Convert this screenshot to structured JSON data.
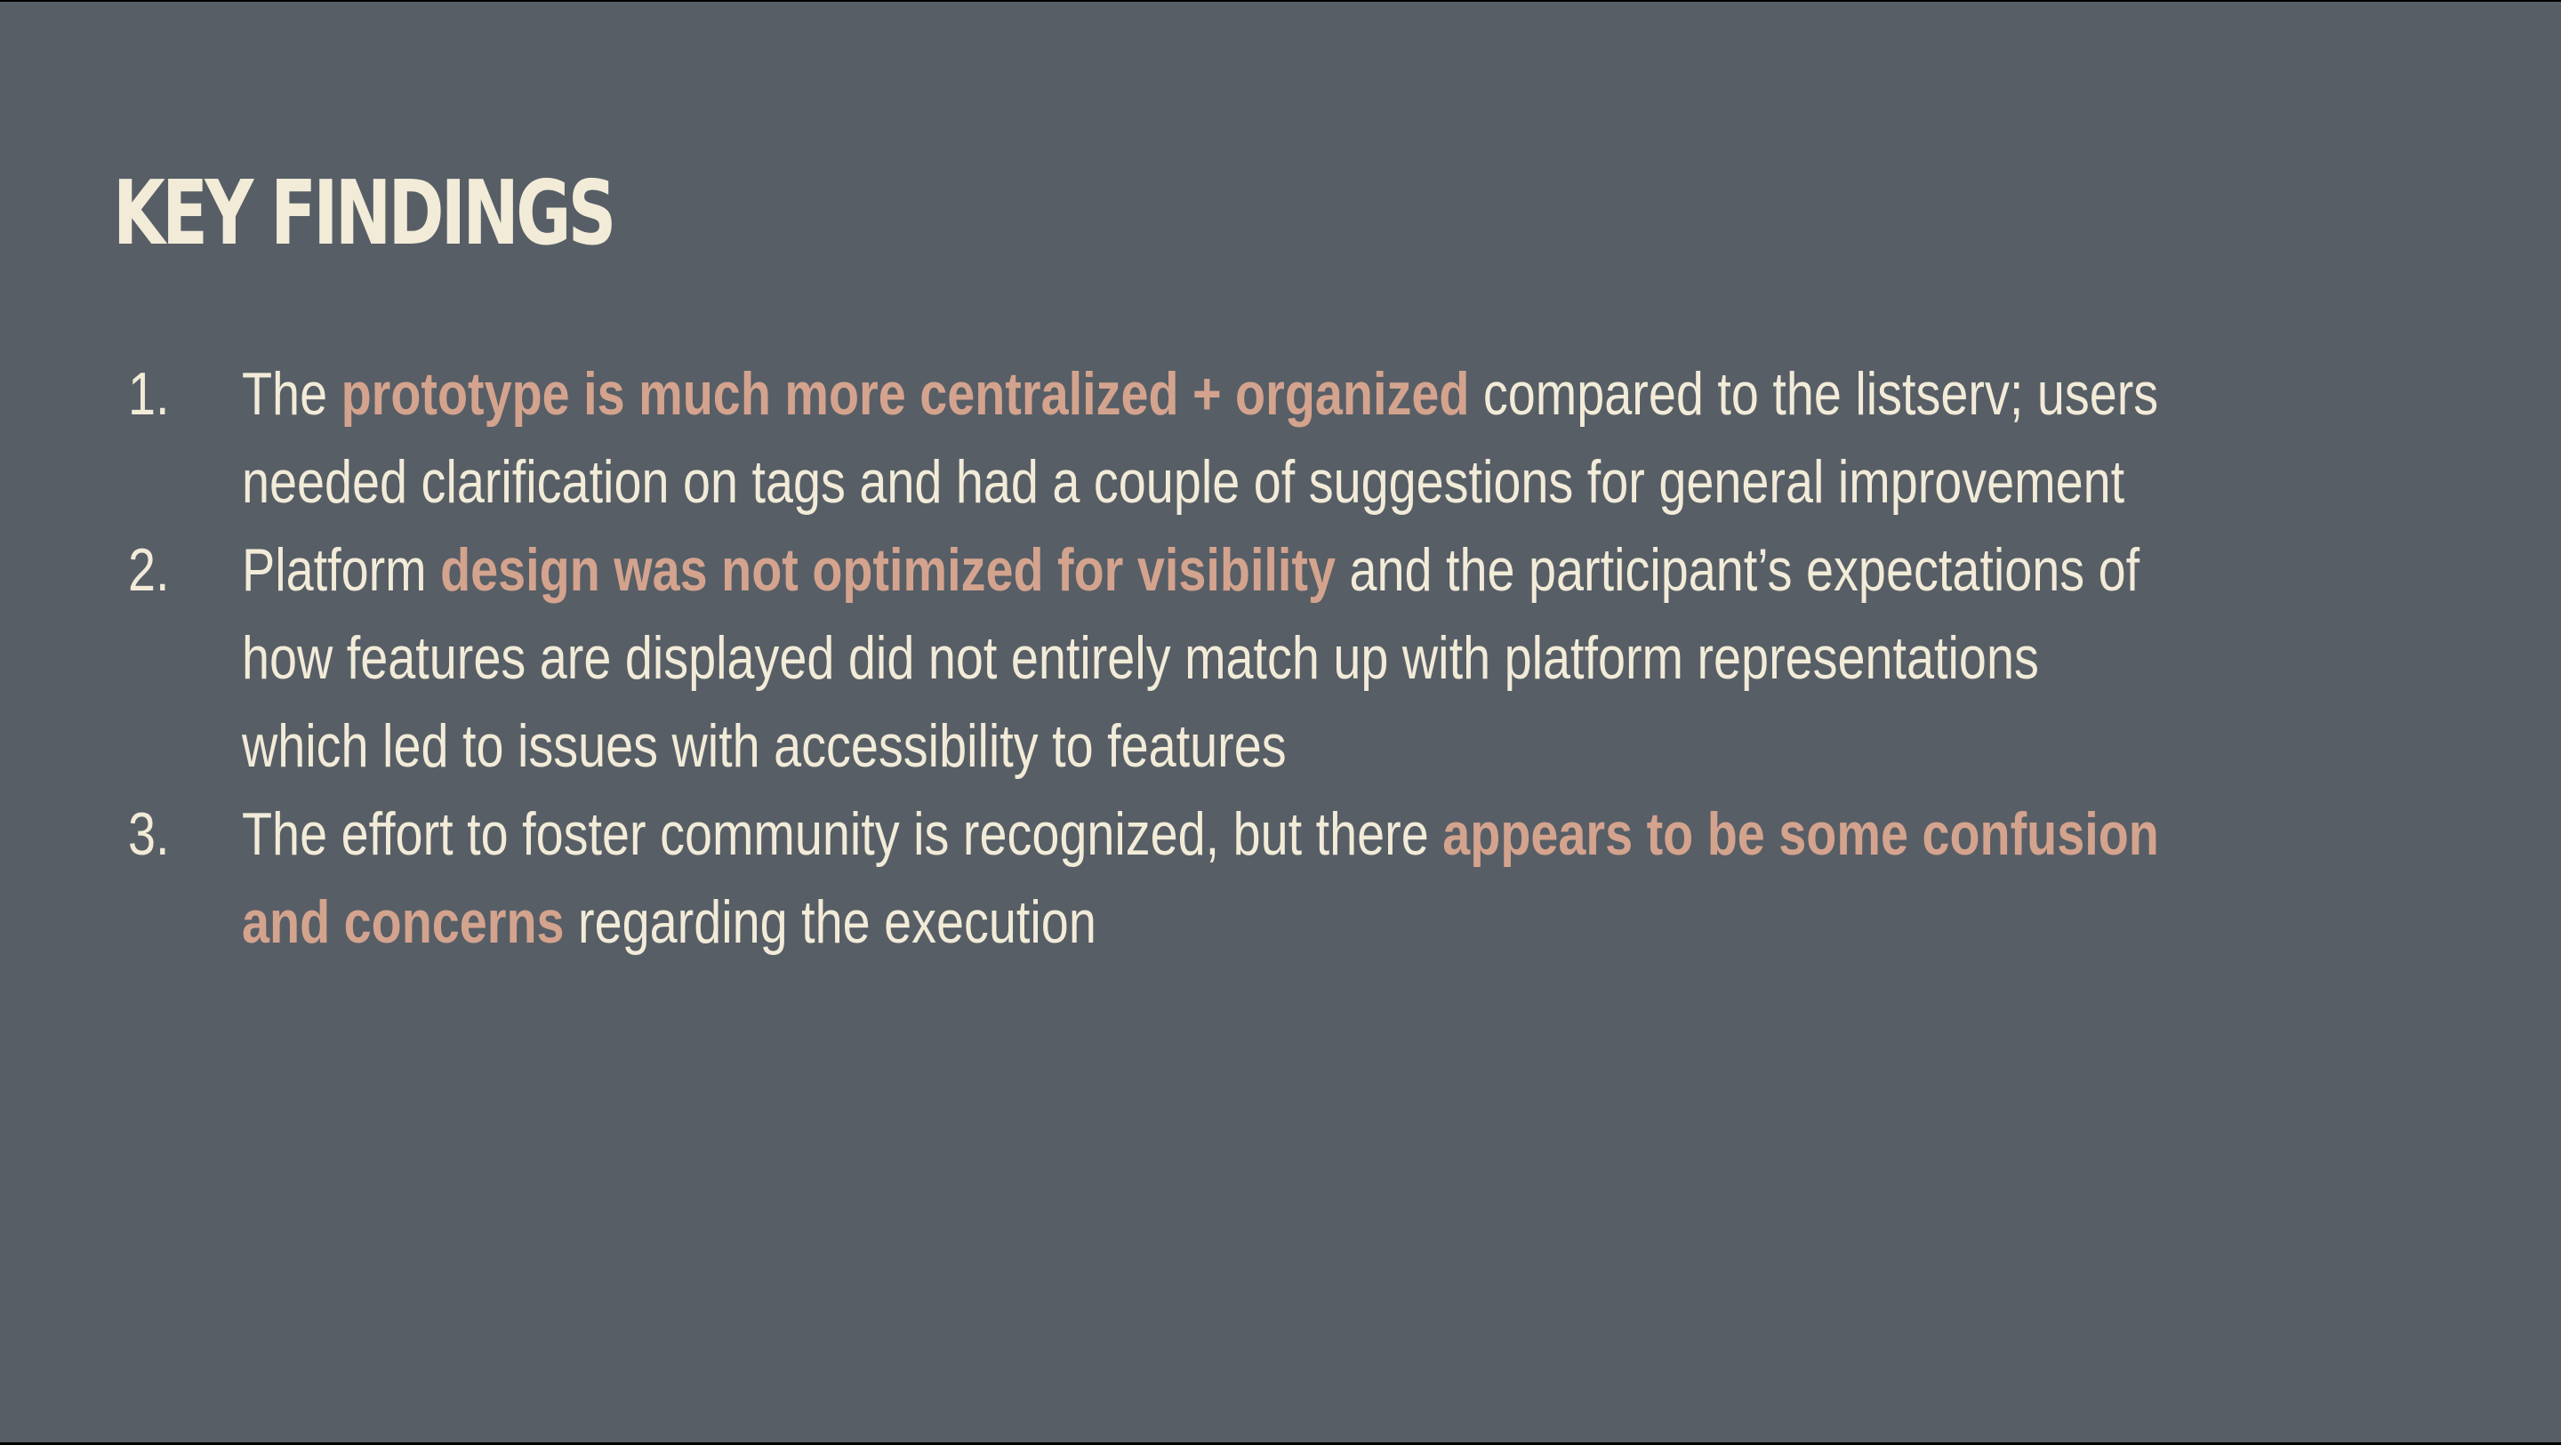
{
  "slide": {
    "title": "KEY FINDINGS",
    "background_color": "#575e66",
    "text_color": "#f1ebd8",
    "highlight_color": "#d4a38e"
  },
  "findings": [
    {
      "number": "1.",
      "line1_part1": "The ",
      "line1_highlight": "prototype is much more centralized + organized",
      "line1_part2": " compared to the listserv; users",
      "line2": "needed clarification on tags and had a couple of suggestions for general improvement"
    },
    {
      "number": "2.",
      "line1_part1": "Platform ",
      "line1_highlight": "design was not optimized for visibility",
      "line1_part2": " and the participant’s expectations of",
      "line2": "how features are displayed did not entirely match up with platform representations",
      "line3": "which led to issues with accessibility to features"
    },
    {
      "number": "3.",
      "line1_part1": "The effort to foster community is recognized, but there ",
      "line1_highlight": "appears to be some confusion",
      "line2_highlight": "and concerns",
      "line2_part2": " regarding the execution"
    }
  ]
}
